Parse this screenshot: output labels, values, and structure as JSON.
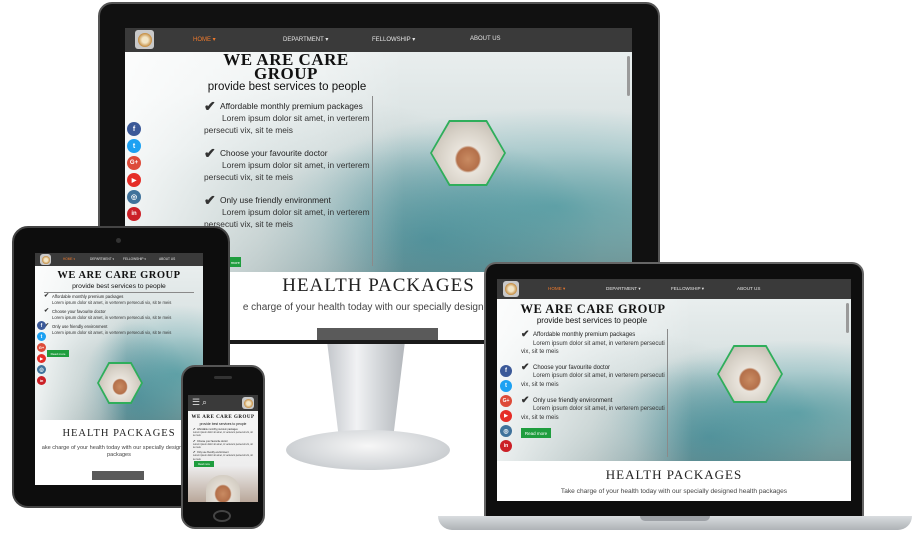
{
  "colors": {
    "accent": "#f07a2c",
    "nav_bg": "#3a3a3a",
    "green": "#1f9d3e",
    "bezel": "#111111"
  },
  "site": {
    "title": "WE ARE CARE GROUP",
    "title_line1": "WE ARE CARE",
    "title_line2": "GROUP",
    "subtitle": "provide best services to people",
    "nav": [
      "HOME ▾",
      "DEPARTMENT ▾",
      "FELLOWSHIP ▾",
      "ABOUT US"
    ],
    "features": [
      {
        "title": "Affordable monthly premium packages",
        "desc": "Lorem ipsum dolor sit amet, in verterem persecuti vix, sit te meis"
      },
      {
        "title": "Choose your favourite doctor",
        "desc": "Lorem ipsum dolor sit amet, in verterem persecuti vix, sit te meis"
      },
      {
        "title": "Only use friendly environment",
        "desc": "Lorem ipsum dolor sit amet, in verterem persecuti vix, sit te meis"
      }
    ],
    "cta": "Read more",
    "packages_title": "HEALTH PACKAGES",
    "packages_sub": "Take charge of your health today with our specially designed health packages",
    "packages_sub_monitor": "e charge of your health today with our specially designed hea",
    "packages_sub_tablet": "ake charge of your health today with our specially designed he",
    "packages_sub_tablet2": "packages",
    "social": [
      {
        "name": "facebook",
        "glyph": "f",
        "color": "#3b5998"
      },
      {
        "name": "twitter",
        "glyph": "t",
        "color": "#1da1f2"
      },
      {
        "name": "google-plus",
        "glyph": "G+",
        "color": "#dd4b39"
      },
      {
        "name": "youtube",
        "glyph": "▶",
        "color": "#e52d27"
      },
      {
        "name": "instagram",
        "glyph": "◎",
        "color": "#3f729b"
      },
      {
        "name": "linkedin",
        "glyph": "in",
        "color": "#cb2027"
      }
    ],
    "phone_menu_icon": "☰",
    "phone_search_icon": "⌕"
  }
}
